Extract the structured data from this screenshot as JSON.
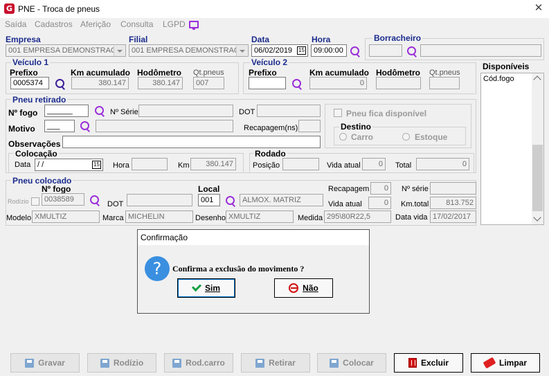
{
  "window": {
    "title": "PNE - Troca de pneus",
    "close_glyph": "✕"
  },
  "menu": [
    "Saída",
    "Cadastros",
    "Aferição",
    "Consulta",
    "LGPD"
  ],
  "header": {
    "empresa_label": "Empresa",
    "empresa_value": "001 EMPRESA DEMONSTRAC",
    "filial_label": "Filial",
    "filial_value": "001 EMPRESA DEMONSTRAC",
    "data_label": "Data",
    "data_value": "06/02/2019",
    "hora_label": "Hora",
    "hora_value": "09:00:00",
    "borracheiro_label": "Borracheiro"
  },
  "veiculo1": {
    "title": "Veículo 1",
    "prefixo_label": "Prefixo",
    "prefixo_value": "0005374",
    "km_label": "Km acumulado",
    "km_value": "380.147",
    "hodometro_label": "Hodômetro",
    "hodometro_value": "380.147",
    "qt_label": "Qt.pneus",
    "qt_value": "007"
  },
  "veiculo2": {
    "title": "Veículo 2",
    "prefixo_label": "Prefixo",
    "prefixo_value": "",
    "km_label": "Km acumulado",
    "km_value": "0",
    "hodometro_label": "Hodômetro",
    "hodometro_value": "",
    "qt_label": "Qt.pneus",
    "qt_value": ""
  },
  "disponiveis": {
    "title": "Disponíveis",
    "items": [
      "Cód.fogo"
    ]
  },
  "pneu_retirado": {
    "title": "Pneu retirado",
    "nfogo_label": "Nº fogo",
    "nfogo_value": "______",
    "nserie_label": "Nº Série",
    "dot_label": "DOT",
    "motivo_label": "Motivo",
    "motivo_value": "___",
    "recapagem_label": "Recapagem(ns)",
    "obs_label": "Observações",
    "disponivel_label": "Pneu fica disponível",
    "destino_title": "Destino",
    "destino_carro": "Carro",
    "destino_estoque": "Estoque"
  },
  "colocacao": {
    "title": "Colocação",
    "data_label": "Data",
    "data_value": " /  /",
    "hora_label": "Hora",
    "km_label": "Km",
    "km_value": "380.147"
  },
  "rodado": {
    "title": "Rodado",
    "posicao_label": "Posição",
    "vida_label": "Vida atual",
    "vida_value": "0",
    "total_label": "Total",
    "total_value": "0"
  },
  "pneu_colocado": {
    "title": "Pneu colocado",
    "nfogo_label": "Nº fogo",
    "nfogo_value": "0038589",
    "rodizio_label": "Rodízio",
    "dot_label": "DOT",
    "local_label": "Local",
    "local_code": "001",
    "local_name": "ALMOX. MATRIZ",
    "recapagem_label": "Recapagem",
    "recapagem_value": "0",
    "vida_label": "Vida atual",
    "vida_value": "0",
    "nserie_label": "Nº série",
    "kmtotal_label": "Km.total",
    "kmtotal_value": "813.752",
    "modelo_label": "Modelo",
    "modelo_value": "XMULTIZ",
    "marca_label": "Marca",
    "marca_value": "MICHELIN",
    "desenho_label": "Desenho",
    "desenho_value": "XMULTIZ",
    "medida_label": "Medida",
    "medida_value": "295\\80R22,5",
    "datavida_label": "Data vida",
    "datavida_value": "17/02/2017"
  },
  "dialog": {
    "title": "Confirmação",
    "message": "Confirma a exclusão do movimento ?",
    "yes_label": "Sim",
    "no_label": "Não"
  },
  "toolbar": {
    "gravar": "Gravar",
    "rodizio": "Rodízio",
    "rodcarro": "Rod.carro",
    "retirar": "Retirar",
    "colocar": "Colocar",
    "excluir": "Excluir",
    "limpar": "Limpar"
  }
}
